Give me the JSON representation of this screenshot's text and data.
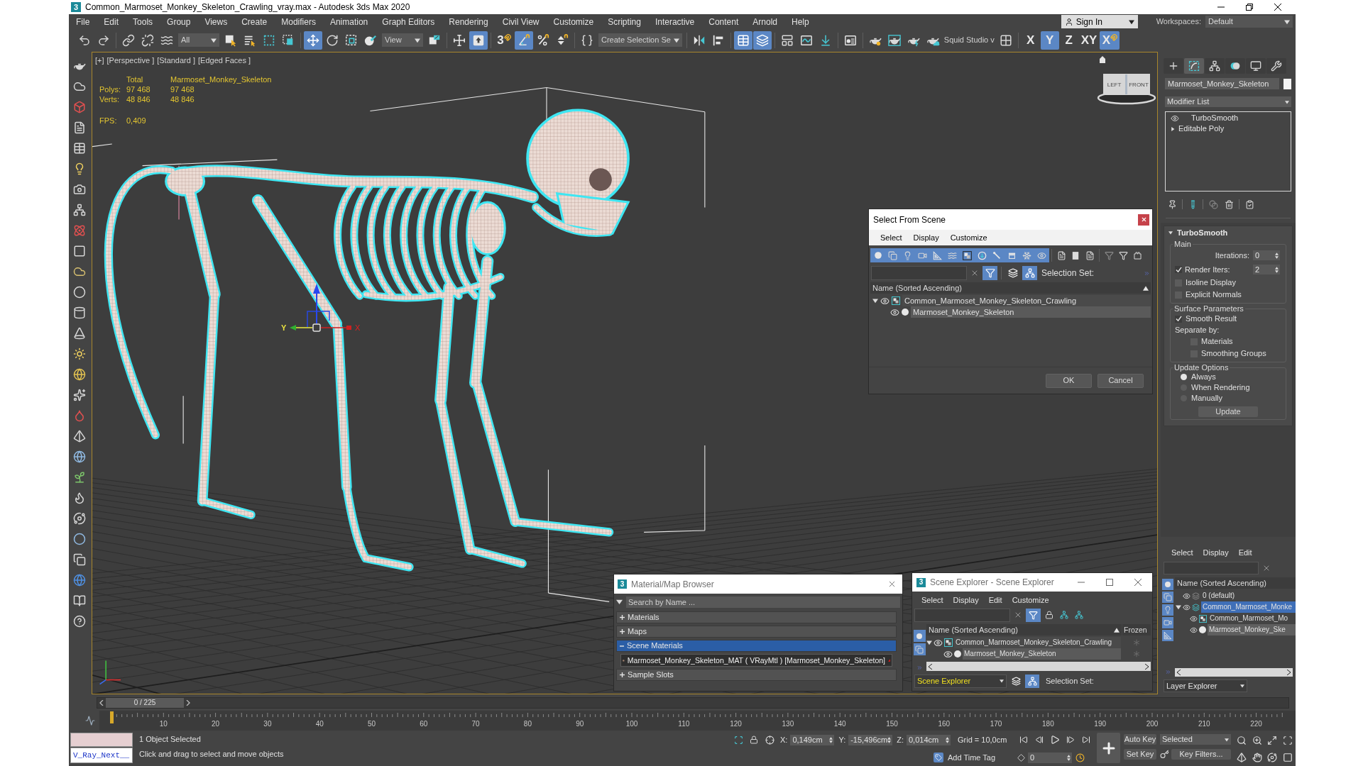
{
  "window": {
    "logo": "3",
    "title": "Common_Marmoset_Monkey_Skeleton_Crawling_vray.max - Autodesk 3ds Max 2020"
  },
  "menu": [
    "File",
    "Edit",
    "Tools",
    "Group",
    "Views",
    "Create",
    "Modifiers",
    "Animation",
    "Graph Editors",
    "Rendering",
    "Civil View",
    "Customize",
    "Scripting",
    "Interactive",
    "Content",
    "Arnold",
    "Help"
  ],
  "account": {
    "label": "Sign In"
  },
  "workspaces": {
    "label": "Workspaces:",
    "value": "Default"
  },
  "toolbar": [
    [
      {
        "kind": "button",
        "selected": false
      },
      {
        "kind": "button",
        "selected": false
      }
    ],
    [
      {
        "kind": "button",
        "selected": false
      },
      {
        "kind": "button",
        "selected": false
      },
      {
        "kind": "button",
        "selected": false
      },
      {
        "kind": "dropdown",
        "value": "All"
      },
      {
        "kind": "button",
        "selected": false
      },
      {
        "kind": "button",
        "selected": false
      },
      {
        "kind": "button",
        "selected": false
      },
      {
        "kind": "button",
        "selected": false
      }
    ],
    [
      {
        "kind": "button",
        "selected": true
      },
      {
        "kind": "button",
        "selected": false
      },
      {
        "kind": "button",
        "selected": false
      },
      {
        "kind": "button",
        "selected": false
      },
      {
        "kind": "dropdown",
        "value": "View"
      },
      {
        "kind": "button",
        "selected": false
      }
    ],
    [
      {
        "kind": "button",
        "selected": false
      },
      {
        "kind": "button",
        "selected": true
      }
    ],
    [
      {
        "kind": "snap",
        "label": "3",
        "selected": false
      },
      {
        "kind": "button",
        "selected": true
      },
      {
        "kind": "button",
        "selected": false
      },
      {
        "kind": "button",
        "selected": false
      }
    ],
    [
      {
        "kind": "button",
        "selected": false
      },
      {
        "kind": "dropdown",
        "value": "Create Selection Se"
      }
    ],
    [
      {
        "kind": "button",
        "selected": false
      },
      {
        "kind": "button",
        "selected": false
      }
    ],
    [
      {
        "kind": "button",
        "selected": true
      },
      {
        "kind": "button",
        "selected": true
      }
    ],
    [
      {
        "kind": "button",
        "selected": false
      },
      {
        "kind": "button",
        "selected": false
      },
      {
        "kind": "button",
        "selected": false
      }
    ],
    [
      {
        "kind": "button",
        "selected": false
      }
    ],
    [
      {
        "kind": "button",
        "selected": false
      },
      {
        "kind": "button",
        "selected": false
      },
      {
        "kind": "button",
        "selected": false
      },
      {
        "kind": "button",
        "selected": false
      },
      {
        "kind": "text",
        "label": "Squid Studio v"
      },
      {
        "kind": "button",
        "selected": false
      }
    ],
    [
      {
        "kind": "axis",
        "label": "X",
        "selected": false
      },
      {
        "kind": "axis",
        "label": "Y",
        "selected": true
      },
      {
        "kind": "axis",
        "label": "Z",
        "selected": false
      },
      {
        "kind": "axis",
        "label": "XY",
        "selected": false
      },
      {
        "kind": "snap",
        "label": "X",
        "selected": true
      }
    ]
  ],
  "viewport": {
    "active": true,
    "labels": [
      "[+]",
      "[Perspective ]",
      "[Standard ]",
      "[Edged Faces ]"
    ],
    "stats": {
      "columns": [
        "Total",
        "Marmoset_Monkey_Skeleton"
      ],
      "rows": [
        {
          "label": "Polys:",
          "values": [
            "97 468",
            "97 468"
          ]
        },
        {
          "label": "Verts:",
          "values": [
            "48 846",
            "48 846"
          ]
        }
      ]
    },
    "fps": {
      "label": "FPS:",
      "value": "0,409"
    },
    "gizmo": [
      "Y",
      "X"
    ],
    "viewcube": [
      "LEFT",
      "FRONT"
    ]
  },
  "select_from_scene": {
    "title": "Select From Scene",
    "menu": [
      "Select",
      "Display",
      "Customize"
    ],
    "filters": [
      {
        "selected": true
      },
      {
        "selected": true
      },
      {
        "selected": true
      },
      {
        "selected": true
      },
      {
        "selected": true
      },
      {
        "selected": true
      },
      {
        "selected": true
      },
      {
        "selected": true
      },
      {
        "selected": true
      },
      {
        "selected": true
      },
      {
        "selected": true
      },
      {
        "selected": true
      }
    ],
    "toggles": [
      {
        "selected": true
      },
      {
        "selected": false
      },
      {
        "selected": true
      }
    ],
    "selection_set": "Selection Set:",
    "column": "Name (Sorted Ascending)",
    "tree": [
      {
        "kind": "group",
        "label": "Common_Marmoset_Monkey_Skeleton_Crawling",
        "selected": false,
        "expanded": true,
        "children": [
          {
            "kind": "object",
            "label": "Marmoset_Monkey_Skeleton",
            "selected": true
          }
        ]
      }
    ],
    "buttons": [
      "OK",
      "Cancel"
    ]
  },
  "material_browser": {
    "logo": "3",
    "title": "Material/Map Browser",
    "search": {
      "placeholder": "Search by Name ..."
    },
    "groups": [
      {
        "label": "Materials",
        "expanded": false,
        "selected": false
      },
      {
        "label": "Maps",
        "expanded": false,
        "selected": false
      },
      {
        "label": "Scene Materials",
        "expanded": true,
        "selected": true,
        "items": [
          {
            "label": "Marmoset_Monkey_Skeleton_MAT ( VRayMtl ) [Marmoset_Monkey_Skeleton]",
            "selected": true
          }
        ]
      },
      {
        "label": "Sample Slots",
        "expanded": false,
        "selected": false
      }
    ]
  },
  "scene_explorer": {
    "logo": "3",
    "title": "Scene Explorer - Scene Explorer",
    "menu": [
      "Select",
      "Display",
      "Edit",
      "Customize"
    ],
    "filters": [
      {
        "selected": true
      },
      {
        "selected": true
      }
    ],
    "toggles": [
      {
        "selected": true
      }
    ],
    "columns": [
      "Name (Sorted Ascending)",
      "Frozen"
    ],
    "tree": [
      {
        "kind": "group",
        "label": "Common_Marmoset_Monkey_Skeleton_Crawling",
        "selected": false,
        "expanded": true,
        "frozen": false,
        "children": [
          {
            "kind": "object",
            "label": "Marmoset_Monkey_Skeleton",
            "selected": true,
            "frozen": false
          }
        ]
      }
    ],
    "mode": "Scene Explorer",
    "bottom_toggles": [
      {
        "selected": false
      },
      {
        "selected": true
      }
    ],
    "selection_set": "Selection Set:"
  },
  "command_panel": {
    "tabs": [
      {
        "selected": false
      },
      {
        "selected": true
      },
      {
        "selected": false
      },
      {
        "selected": false
      },
      {
        "selected": false
      },
      {
        "selected": false
      }
    ],
    "object_name": "Marmoset_Monkey_Skeleton",
    "modifier_list": "Modifier List",
    "stack": [
      {
        "kind": "modifier",
        "label": "TurboSmooth",
        "enabled": true
      },
      {
        "kind": "base",
        "label": "Editable Poly",
        "expanded": false
      }
    ],
    "rollout": {
      "title": "TurboSmooth",
      "expanded": true,
      "groups": [
        {
          "title": "Main",
          "items": [
            {
              "kind": "spinner",
              "label": "Iterations:",
              "value": "0"
            },
            {
              "kind": "check_spinner",
              "label": "Render Iters:",
              "value": "2",
              "checked": true
            },
            {
              "kind": "checkbox",
              "label": "Isoline Display",
              "checked": false
            },
            {
              "kind": "checkbox",
              "label": "Explicit Normals",
              "checked": false
            }
          ]
        },
        {
          "title": "Surface Parameters",
          "items": [
            {
              "kind": "checkbox",
              "label": "Smooth Result",
              "checked": true
            },
            {
              "kind": "label",
              "label": "Separate by:",
              "children": [
                {
                  "kind": "checkbox",
                  "label": "Materials",
                  "checked": false
                },
                {
                  "kind": "checkbox",
                  "label": "Smoothing Groups",
                  "checked": false
                }
              ]
            }
          ]
        },
        {
          "title": "Update Options",
          "items": [
            {
              "kind": "radio",
              "label": "Always",
              "selected": true
            },
            {
              "kind": "radio",
              "label": "When Rendering",
              "selected": false
            },
            {
              "kind": "radio",
              "label": "Manually",
              "selected": false
            },
            {
              "kind": "button",
              "label": "Update"
            }
          ]
        }
      ]
    }
  },
  "layer_explorer": {
    "menu": [
      "Select",
      "Display",
      "Edit"
    ],
    "filters": [
      {
        "selected": true
      },
      {
        "selected": true
      },
      {
        "selected": true
      },
      {
        "selected": true
      },
      {
        "selected": true
      }
    ],
    "column": "Name (Sorted Ascending)",
    "tree": [
      {
        "kind": "layer",
        "label": "0 (default)",
        "selected": false,
        "current": false
      },
      {
        "kind": "layer",
        "label": "Common_Marmoset_Monke",
        "selected": true,
        "current": true,
        "expanded": true,
        "children": [
          {
            "kind": "group",
            "label": "Common_Marmoset_Mo",
            "selected": false
          },
          {
            "kind": "object",
            "label": "Marmoset_Monkey_Ske",
            "selected": true
          }
        ]
      }
    ],
    "mode": "Layer Explorer"
  },
  "timeline": {
    "slider": {
      "label": "0 / 225",
      "level": 0
    },
    "ruler": [
      "10",
      "20",
      "30",
      "40",
      "50",
      "60",
      "70",
      "80",
      "90",
      "100",
      "110",
      "120",
      "130",
      "140",
      "150",
      "160",
      "170",
      "180",
      "190",
      "200",
      "210",
      "220"
    ]
  },
  "status": {
    "listener": "V_Ray_Next__",
    "message": "1 Object Selected",
    "prompt": "Click and drag to select and move objects",
    "coords": [
      {
        "label": "X:",
        "value": "0,149cm"
      },
      {
        "label": "Y:",
        "value": "-15,496cm"
      },
      {
        "label": "Z:",
        "value": "0,014cm"
      }
    ],
    "grid": "Grid = 10,0cm",
    "time_tag": "Add Time Tag",
    "frame": "0",
    "auto_key": {
      "label": "Auto Key",
      "on": false
    },
    "set_key": "Set Key",
    "key_mode": "Selected",
    "key_filters": "Key Filters..."
  }
}
